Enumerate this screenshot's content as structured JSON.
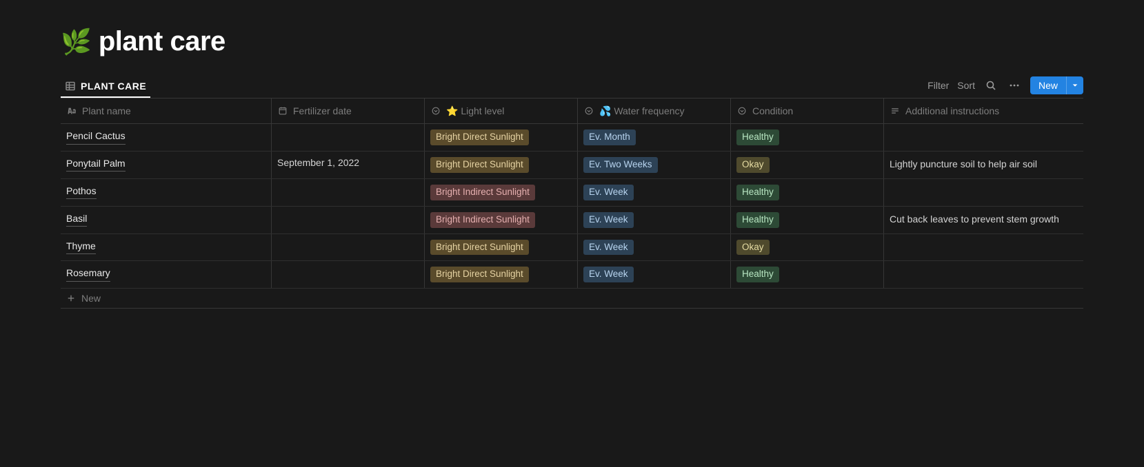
{
  "page": {
    "emoji": "🌿",
    "title": "plant care"
  },
  "view": {
    "active_tab_label": "PLANT CARE"
  },
  "toolbar": {
    "filter": "Filter",
    "sort": "Sort",
    "new": "New"
  },
  "columns": {
    "name": "Plant name",
    "fertilizer": "Fertilizer date",
    "light": "⭐ Light level",
    "water": "💦 Water frequency",
    "condition": "Condition",
    "instructions": "Additional instructions"
  },
  "tags": {
    "light": {
      "direct": "Bright Direct Sunlight",
      "indirect": "Bright Indirect Sunlight"
    },
    "water": {
      "month": "Ev. Month",
      "two_weeks": "Ev. Two Weeks",
      "week": "Ev. Week"
    },
    "condition": {
      "healthy": "Healthy",
      "okay": "Okay"
    }
  },
  "rows": [
    {
      "name": "Pencil Cactus",
      "fertilizer": "",
      "light": "direct",
      "water": "month",
      "condition": "healthy",
      "instructions": ""
    },
    {
      "name": "Ponytail Palm",
      "fertilizer": "September 1, 2022",
      "light": "direct",
      "water": "two_weeks",
      "condition": "okay",
      "instructions": "Lightly puncture soil to help air soil"
    },
    {
      "name": "Pothos",
      "fertilizer": "",
      "light": "indirect",
      "water": "week",
      "condition": "healthy",
      "instructions": ""
    },
    {
      "name": "Basil",
      "fertilizer": "",
      "light": "indirect",
      "water": "week",
      "condition": "healthy",
      "instructions": "Cut back leaves to prevent stem growth"
    },
    {
      "name": "Thyme",
      "fertilizer": "",
      "light": "direct",
      "water": "week",
      "condition": "okay",
      "instructions": ""
    },
    {
      "name": "Rosemary",
      "fertilizer": "",
      "light": "direct",
      "water": "week",
      "condition": "healthy",
      "instructions": ""
    }
  ],
  "new_row_label": "New"
}
